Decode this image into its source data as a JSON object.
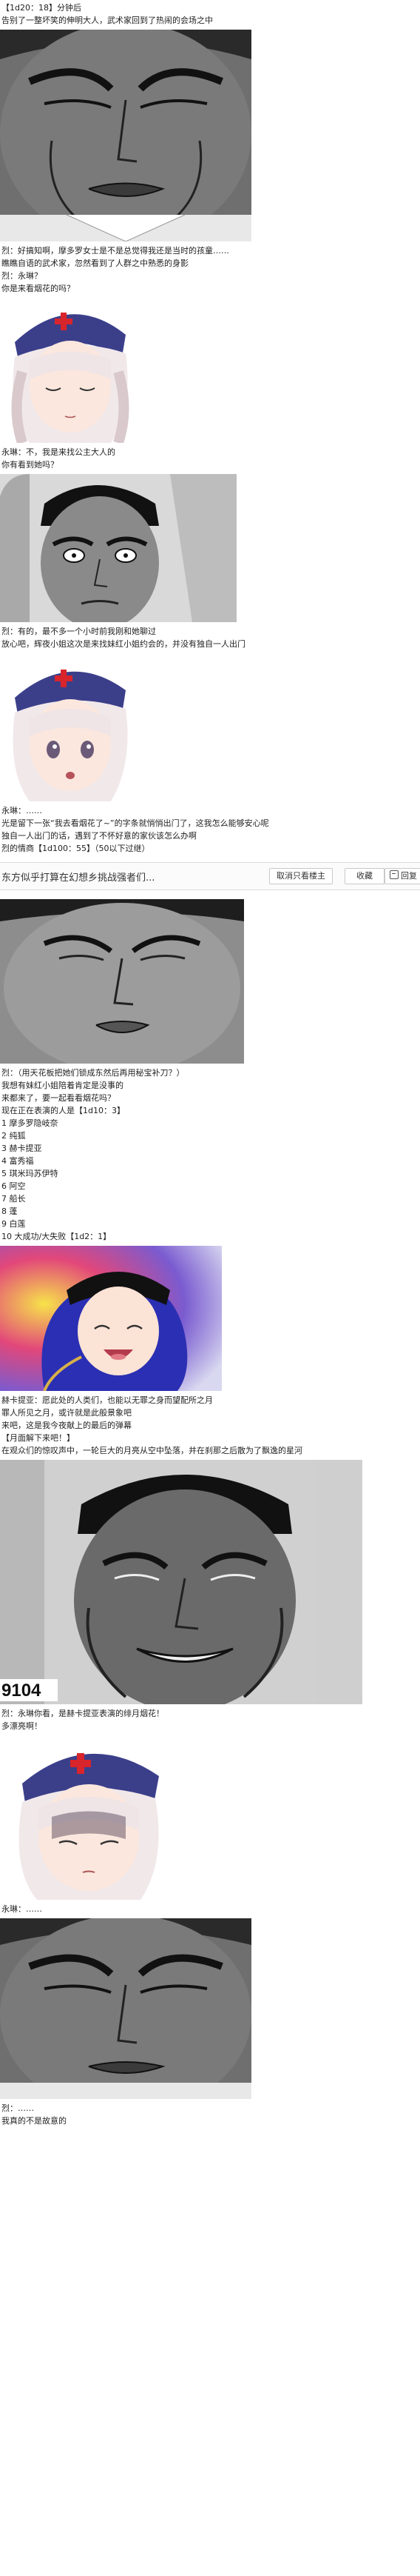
{
  "lines": {
    "l1": "【1d20：18】分钟后",
    "l2": "告别了一整坏笑的伸明大人，武术家回到了热闹的会场之中",
    "l3": "烈：好搞知啊，摩多罗女士是不是总觉得我还是当时的孩童……",
    "l4": "瞧瞧自语的武术家，忽然看到了人群之中熟悉的身影",
    "l5": "烈：永琳？",
    "l6": "你是来看烟花的吗？",
    "l7": "永琳：不，我是来找公主大人的",
    "l8": "你有看到她吗？",
    "l9": "烈：有的，最不多一个小时前我刚和她聊过",
    "l10": "放心吧，辉夜小姐这次是来找妹红小姐约会的，并没有独自一人出门",
    "l11": "永琳：……",
    "l12": "光是留下一张“我去看烟花了~”的字条就悄悄出门了，这我怎么能够安心呢",
    "l13": "独自一人出门的话，遇到了不怀好意的家伙该怎么办啊",
    "l14": "烈的情商【1d100：55】（50以下过继）",
    "l15": "烈：（用天花板把她们锁成东然后再用秘宝补刀？）",
    "l16": "我想有妹红小姐陪着肯定是没事的",
    "l17": "来都来了，要一起看看烟花吗？",
    "l18": "现在正在表演的人是【1d10：3】",
    "l19": "1 摩多罗隐岐奈",
    "l20": "2 纯狐",
    "l21": "3 赫卡提亚",
    "l22": "4 富秀福",
    "l23": "5 琪米玛苏伊特",
    "l24": "6 阿空",
    "l25": "7 船长",
    "l26": "8 蓬",
    "l27": "9 白莲",
    "l28": "10 大成功/大失败【1d2：1】",
    "l29": "赫卡提亚：愿此处的人类们，也能以无罪之身而望配所之月",
    "l30": "罪人所见之月，或许就是此般景象吧",
    "l31": "来吧，这是我今夜献上的最后的弹幕",
    "l32": "【月面解下来吧！】",
    "l33": "在观众们的惊叹声中，一轮巨大的月亮从空中坠落，并在刹那之后散为了飘逸的星河",
    "l34": "烈：永琳你看，是赫卡提亚表演的绯月烟花！",
    "l35": "多漂亮啊！",
    "l36": "永琳：……",
    "l37": "烈：……",
    "l38": "我真的不是故意的"
  },
  "toolbar": {
    "title": "东方似乎打算在幻想乡挑战强者们...",
    "btn_only_op": "取消只看楼主",
    "btn_collect": "收藏",
    "btn_reply": "回复"
  },
  "panels": {
    "manga_number": "9104"
  }
}
